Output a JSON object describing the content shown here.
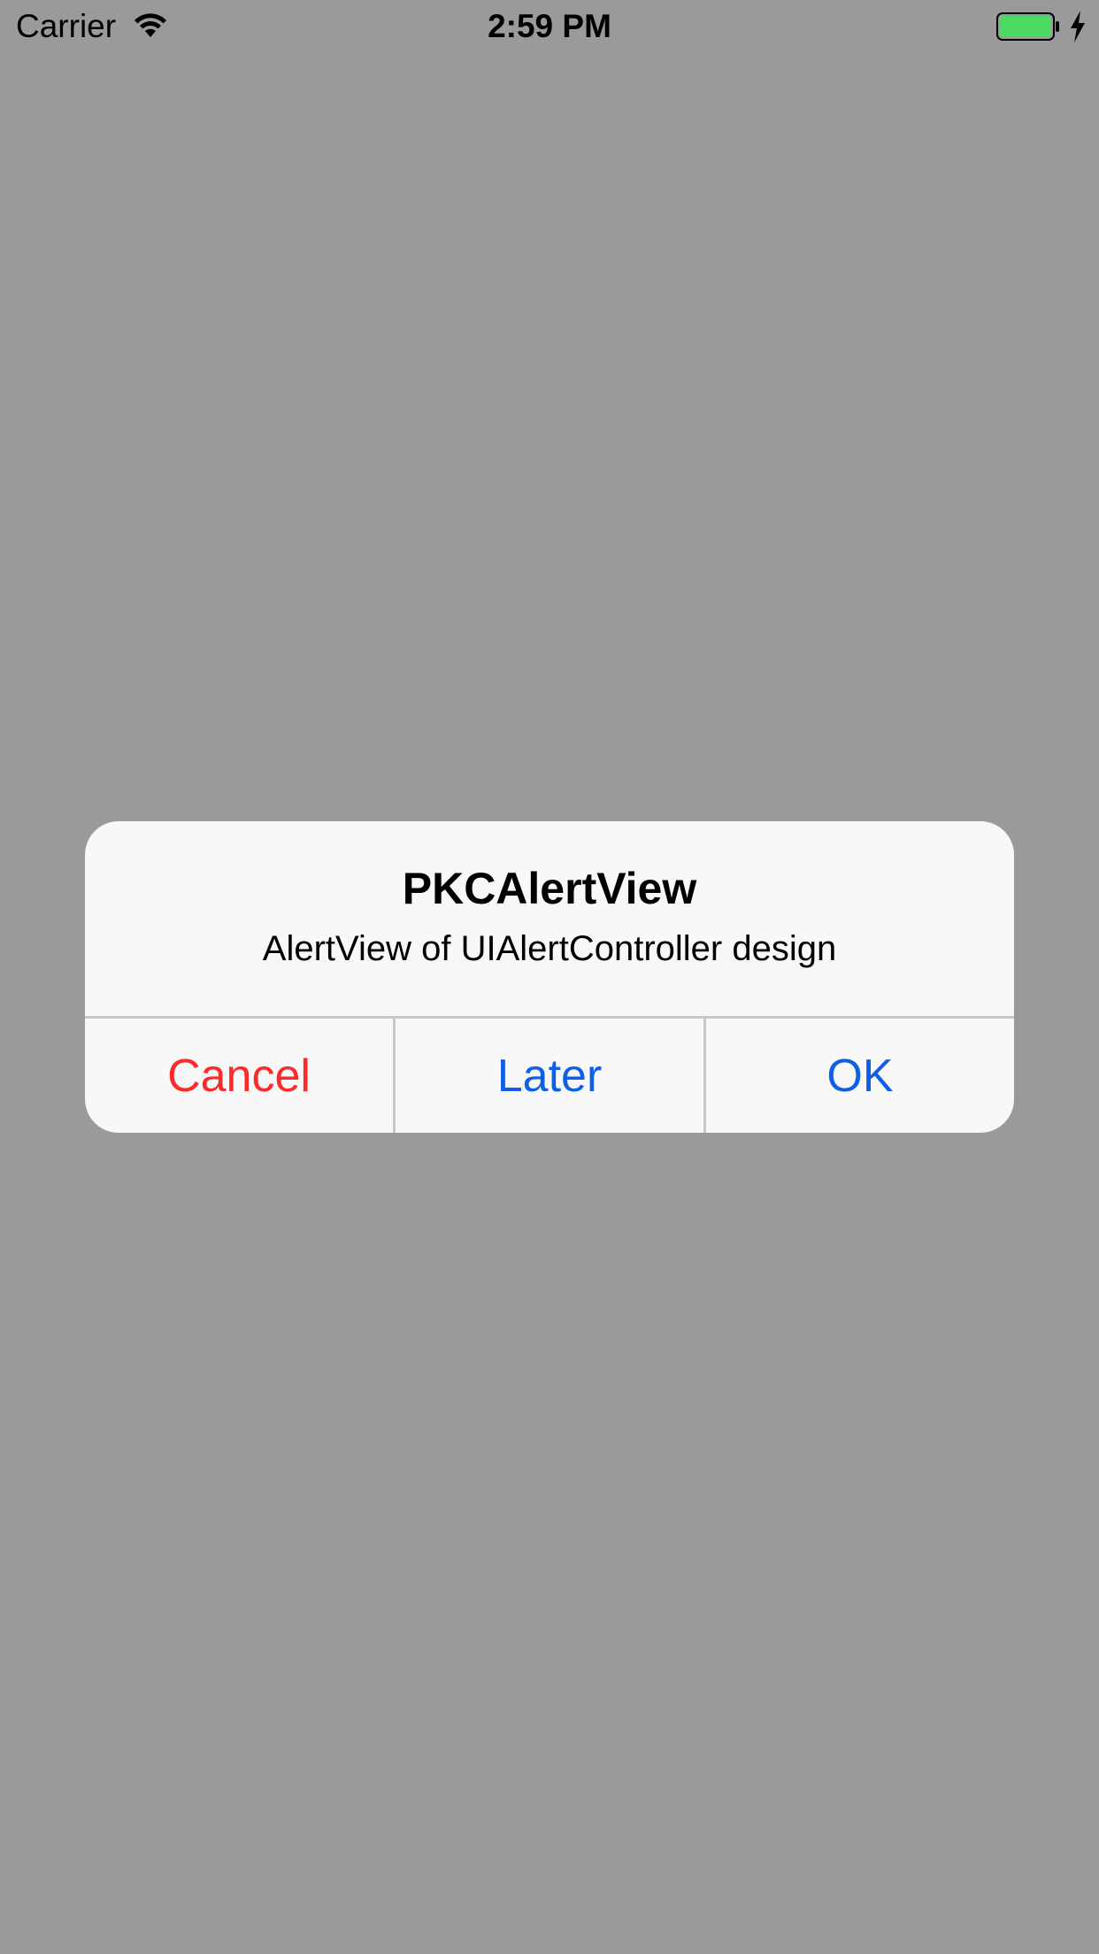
{
  "status_bar": {
    "carrier": "Carrier",
    "time": "2:59 PM",
    "wifi_icon": "wifi-icon",
    "battery_icon": "battery-icon",
    "charging_icon": "charging-bolt-icon",
    "battery_level": 1.0,
    "battery_color": "#4cd964"
  },
  "alert": {
    "title": "PKCAlertView",
    "message": "AlertView of UIAlertController design",
    "buttons": [
      {
        "label": "Cancel",
        "color": "#fc2b2b"
      },
      {
        "label": "Later",
        "color": "#0f5fe6"
      },
      {
        "label": "OK",
        "color": "#0f5fe6"
      }
    ]
  },
  "colors": {
    "dimmed_background": "#9a9a9a",
    "alert_background": "#f8f8f8",
    "separator": "#c8c8c8"
  }
}
